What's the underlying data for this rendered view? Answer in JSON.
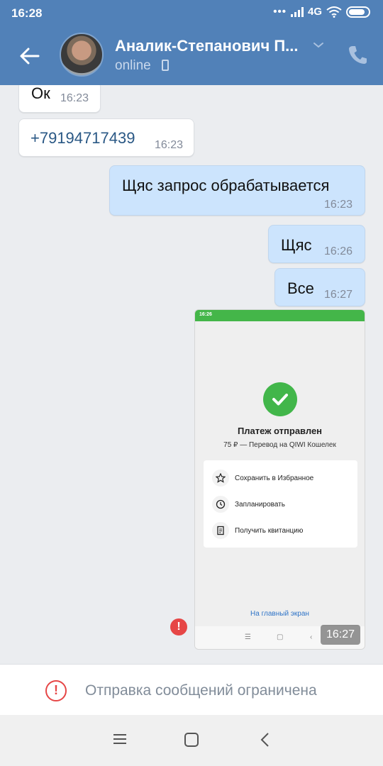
{
  "status_bar": {
    "time": "16:28",
    "dots": "•••",
    "network": "4G"
  },
  "header": {
    "contact_name": "Аналик-Степанович П...",
    "status": "online"
  },
  "messages": [
    {
      "dir": "in",
      "text": "Ок",
      "time": "16:23"
    },
    {
      "dir": "in",
      "text": "+79194717439",
      "time": "16:23"
    },
    {
      "dir": "out",
      "text": "Щяс запрос обрабатывается",
      "time": "16:23"
    },
    {
      "dir": "out",
      "text": "Щяс",
      "time": "16:26"
    },
    {
      "dir": "out",
      "text": "Все",
      "time": "16:27"
    }
  ],
  "attachment": {
    "status_time": "16:26",
    "title": "Платеж отправлен",
    "subtitle": "75 ₽ — Перевод на QIWI Кошелек",
    "actions": [
      "Сохранить в Избранное",
      "Запланировать",
      "Получить квитанцию"
    ],
    "home_link": "На главный экран",
    "time": "16:27"
  },
  "error_mark": "!",
  "banner": {
    "text": "Отправка сообщений ограничена"
  },
  "colors": {
    "header": "#5181b8",
    "outgoing": "#cce4fd",
    "error": "#e64646",
    "success": "#42b64a"
  }
}
